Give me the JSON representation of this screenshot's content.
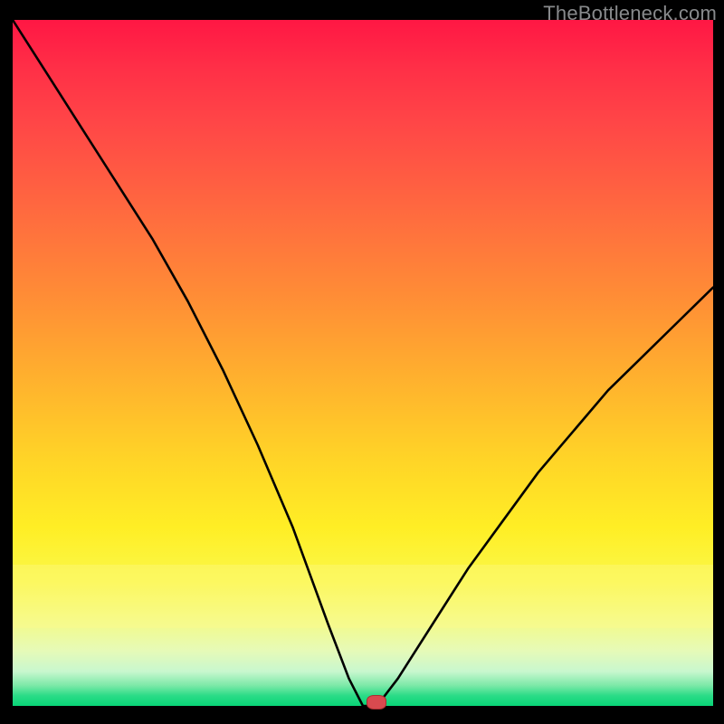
{
  "watermark": {
    "text": "TheBottleneck.com"
  },
  "colors": {
    "curve_stroke": "#000000",
    "marker_fill": "#d94a4f",
    "background_black": "#000000"
  },
  "chart_data": {
    "type": "line",
    "title": "",
    "xlabel": "",
    "ylabel": "",
    "xlim": [
      0,
      100
    ],
    "ylim": [
      0,
      100
    ],
    "x": [
      0,
      5,
      10,
      15,
      20,
      25,
      30,
      35,
      40,
      45,
      48,
      50,
      52,
      55,
      60,
      65,
      70,
      75,
      80,
      85,
      90,
      95,
      100
    ],
    "values": [
      100,
      92,
      84,
      76,
      68,
      59,
      49,
      38,
      26,
      12,
      4,
      0,
      0,
      4,
      12,
      20,
      27,
      34,
      40,
      46,
      51,
      56,
      61
    ],
    "marker": {
      "x": 52,
      "y": 0
    },
    "note": "Values are relative percentages estimated from the unlabeled plot; curve has a V-shaped minimum near x≈50–52 with a short flat bottom, left branch steeper and reaching 100 at x=0, right branch rising to ≈61 at x=100."
  }
}
